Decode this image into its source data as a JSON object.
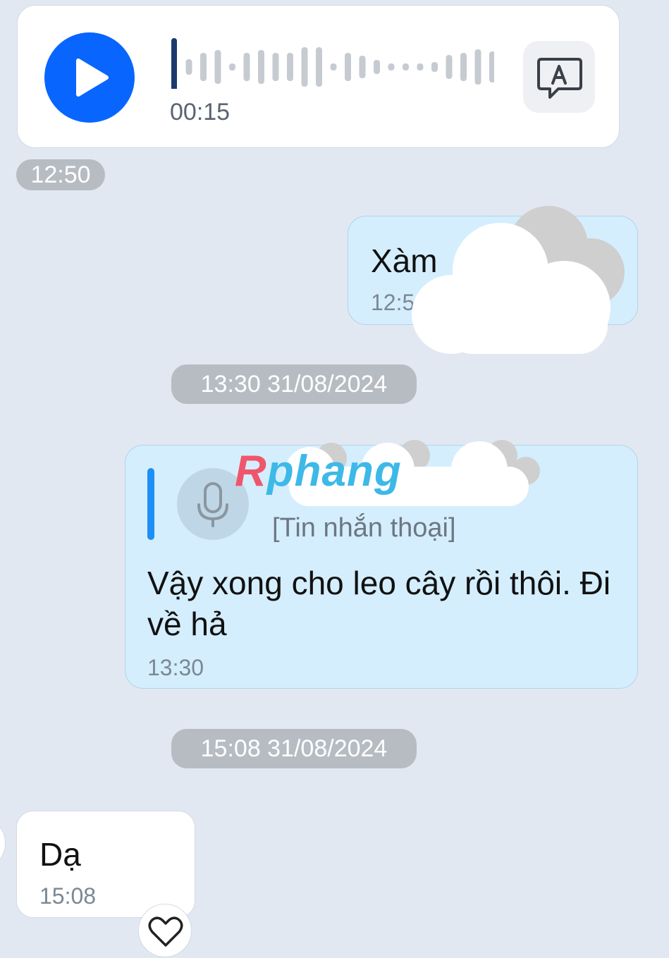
{
  "voice_message": {
    "duration": "00:15",
    "play_icon": "play-icon",
    "transcribe_icon": "text-speech-icon"
  },
  "separator_1": "12:50",
  "sent_message": {
    "text": "Xàm",
    "time": "12:5"
  },
  "separator_2": "13:30 31/08/2024",
  "reply_message": {
    "quote_type": "[Tin nhắn thoại]",
    "text": "Vậy xong cho leo cây rồi thôi. Đi về hả",
    "time": "13:30"
  },
  "watermark": {
    "first": "R",
    "rest": "phang"
  },
  "separator_3": "15:08 31/08/2024",
  "received_message": {
    "text": "Dạ",
    "time": "15:08"
  },
  "reaction_icon": "heart-icon",
  "colors": {
    "accent": "#0866ff",
    "sent_bubble": "#d4eefe",
    "background": "#e2e8f1",
    "pill": "#b7bcc3"
  }
}
